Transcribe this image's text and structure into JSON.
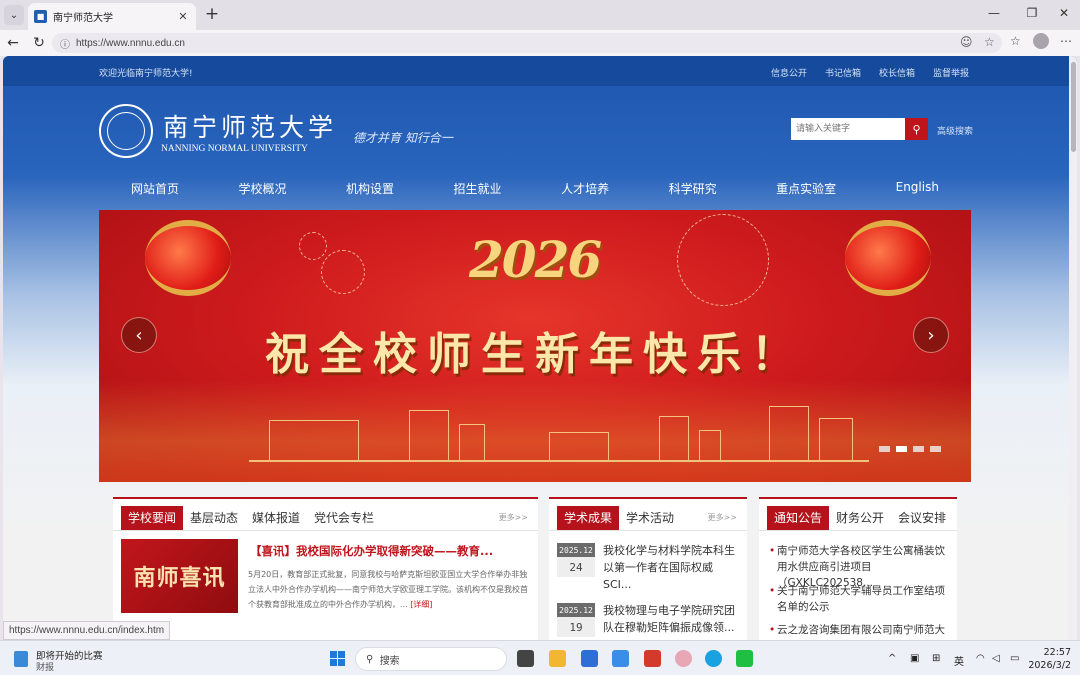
{
  "browser": {
    "tab_title": "南宁师范大学",
    "url": "https://www.nnnu.edu.cn",
    "status_url": "https://www.nnnu.edu.cn/index.htm"
  },
  "site": {
    "welcome": "欢迎光临南宁师范大学!",
    "top_links": [
      "信息公开",
      "书记信箱",
      "校长信箱",
      "监督举报"
    ],
    "logo_cn": "南宁师范大学",
    "logo_en": "NANNING NORMAL UNIVERSITY",
    "motto": "德才并育 知行合一",
    "search_placeholder": "请输入关键字",
    "advanced_search": "高级搜索",
    "nav": [
      "网站首页",
      "学校概况",
      "机构设置",
      "招生就业",
      "人才培养",
      "科学研究",
      "重点实验室",
      "English"
    ]
  },
  "banner": {
    "year": "2026",
    "greeting": "祝全校师生新年快乐！",
    "slide_count": 4,
    "active_slide": 2
  },
  "news": {
    "tabs": [
      "学校要闻",
      "基层动态",
      "媒体报道",
      "党代会专栏"
    ],
    "more": "更多>>",
    "image_text": "南师喜讯",
    "headline": "【喜讯】我校国际化办学取得新突破——教育...",
    "summary": "5月20日，教育部正式批复，同意我校与哈萨克斯坦欧亚国立大学合作举办非独立法人中外合作办学机构——南宁师范大学欧亚理工学院。该机构不仅是我校首个获教育部批准成立的中外合作办学机构，...",
    "detail_link": "[详细]"
  },
  "achievements": {
    "tabs": [
      "学术成果",
      "学术活动"
    ],
    "more": "更多>>",
    "items": [
      {
        "ym": "2025.12",
        "day": "24",
        "title": "我校化学与材料学院本科生以第一作者在国际权威SCI..."
      },
      {
        "ym": "2025.12",
        "day": "19",
        "title": "我校物理与电子学院研究团队在穆勒矩阵偏振成像领..."
      }
    ]
  },
  "notices": {
    "tabs": [
      "通知公告",
      "财务公开",
      "会议安排"
    ],
    "items": [
      "南宁师范大学各校区学生公寓桶装饮用水供应商引进项目（GXKLC202538...",
      "关于南宁师范大学辅导员工作室结项名单的公示",
      "云之龙咨询集团有限公司南宁师范大学"
    ]
  },
  "taskbar": {
    "weather_title": "即将开始的比赛",
    "weather_sub": "财报",
    "search": "搜索",
    "ime": "英",
    "time": "22:57",
    "date": "2026/3/2"
  }
}
